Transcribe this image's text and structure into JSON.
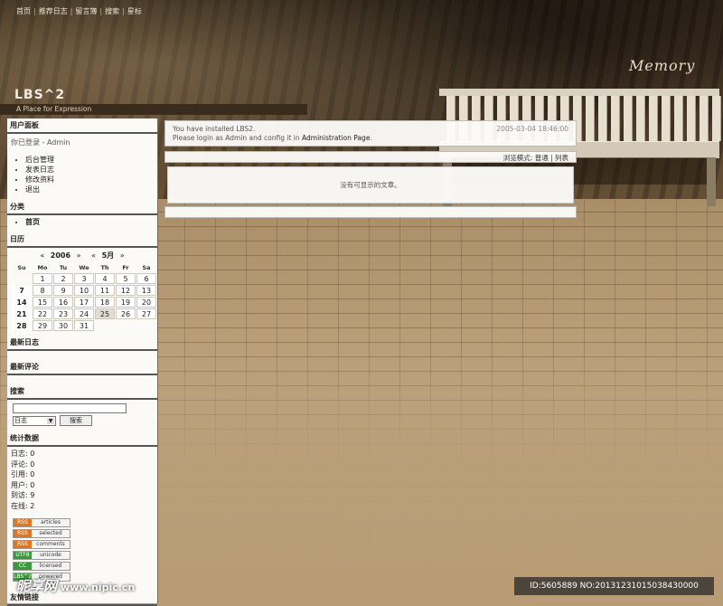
{
  "nav": {
    "items": [
      "首页",
      "推荐日志",
      "留言簿",
      "搜索",
      "星标"
    ],
    "separator": "|"
  },
  "site": {
    "title": "LBS^2",
    "tagline": "A Place for Expression",
    "logo_text": "Memory"
  },
  "sidebar": {
    "user_panel": {
      "title": "用户面板",
      "status": "你已登录 - Admin",
      "links": [
        "后台管理",
        "发表日志",
        "修改资料",
        "退出"
      ]
    },
    "categories": {
      "title": "分类",
      "items": [
        "首页"
      ]
    },
    "calendar": {
      "title": "日历",
      "year_prev": "«",
      "year": "2006",
      "year_next": "»",
      "month_prev": "«",
      "month": "5月",
      "month_next": "»",
      "weekdays": [
        "Su",
        "Mo",
        "Tu",
        "We",
        "Th",
        "Fr",
        "Sa"
      ],
      "today": "25",
      "weeks": [
        [
          "",
          "1",
          "2",
          "3",
          "4",
          "5",
          "6"
        ],
        [
          "7",
          "8",
          "9",
          "10",
          "11",
          "12",
          "13"
        ],
        [
          "14",
          "15",
          "16",
          "17",
          "18",
          "19",
          "20"
        ],
        [
          "21",
          "22",
          "23",
          "24",
          "25",
          "26",
          "27"
        ],
        [
          "28",
          "29",
          "30",
          "31",
          "",
          "",
          ""
        ]
      ]
    },
    "latest_posts": {
      "title": "最新日志"
    },
    "latest_comments": {
      "title": "最新评论"
    },
    "search": {
      "title": "搜索",
      "input_value": "",
      "scope_selected": "日志",
      "button_label": "搜索"
    },
    "stats": {
      "title": "统计数据",
      "lines": [
        "日志: 0",
        "评论: 0",
        "引用: 0",
        "用户: 0",
        "到访: 9",
        "在线: 2"
      ]
    },
    "badges": [
      {
        "left": "RSS",
        "right": "articles",
        "color": "#e0761e"
      },
      {
        "left": "RSS",
        "right": "selected",
        "color": "#e0761e"
      },
      {
        "left": "RSS",
        "right": "comments",
        "color": "#e0761e"
      },
      {
        "left": "UTF8",
        "right": "unicode",
        "color": "#3a9a3a"
      },
      {
        "left": "CC",
        "right": "licensed",
        "color": "#3a9a3a"
      },
      {
        "left": "LBS^2",
        "right": "powered",
        "color": "#3a9a3a"
      }
    ],
    "links": {
      "title": "友情链接"
    }
  },
  "main": {
    "notice_line1": "You have installed LBS2.",
    "notice_line2_pre": "Please login as Admin and config it in ",
    "notice_link": "Administration Page",
    "notice_line2_post": ".",
    "notice_datetime": "2005-03-04 18:46:00",
    "view_mode": "浏览模式: 普通 | 列表",
    "empty_message": "没有可显示的文章。"
  },
  "overlay": {
    "watermark": "昵享网",
    "watermark_url": "www.nipic.cn",
    "image_id": "ID:5605889 NO:20131231015038430000"
  }
}
